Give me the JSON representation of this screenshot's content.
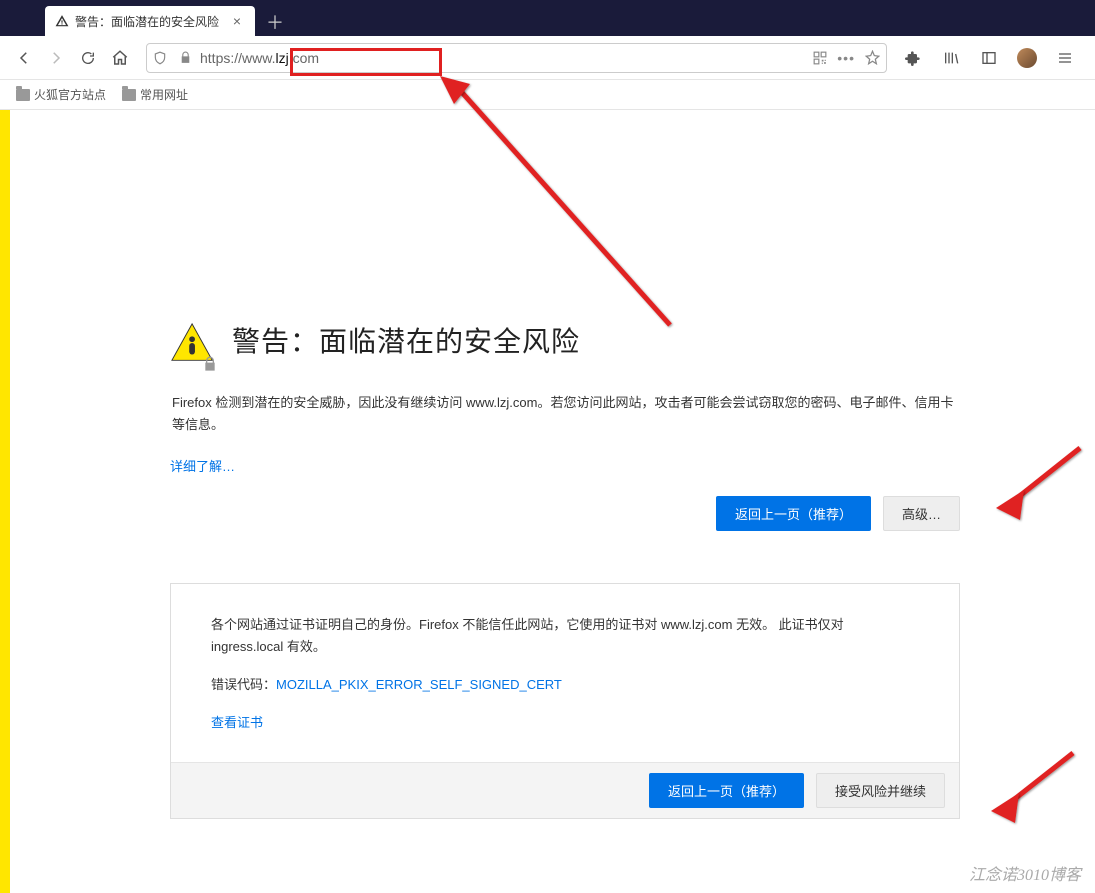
{
  "tab": {
    "title": "警告：面临潜在的安全风险"
  },
  "url": {
    "scheme": "https://www.",
    "domain": "lzj",
    "tld": ".com"
  },
  "bookmarks": {
    "item1": "火狐官方站点",
    "item2": "常用网址"
  },
  "error": {
    "title": "警告：面临潜在的安全风险",
    "paragraph": "Firefox 检测到潜在的安全威胁，因此没有继续访问 www.lzj.com。若您访问此网站，攻击者可能会尝试窃取您的密码、电子邮件、信用卡等信息。",
    "learn_more": "详细了解…",
    "go_back": "返回上一页（推荐）",
    "advanced": "高级…"
  },
  "advanced_panel": {
    "para": "各个网站通过证书证明自己的身份。Firefox 不能信任此网站，它使用的证书对 www.lzj.com 无效。 此证书仅对 ingress.local 有效。",
    "error_code_label": "错误代码：",
    "error_code": "MOZILLA_PKIX_ERROR_SELF_SIGNED_CERT",
    "view_cert": "查看证书",
    "go_back": "返回上一页（推荐）",
    "accept_risk": "接受风险并继续"
  },
  "watermark": "江念诺3010博客"
}
